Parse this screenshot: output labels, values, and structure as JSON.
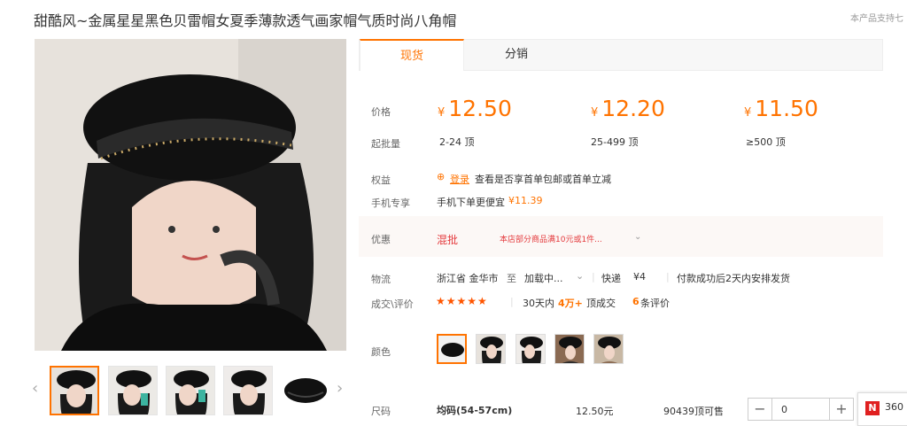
{
  "product": {
    "title": "甜酷风~金属星星黑色贝雷帽女夏季薄款透气画家帽气质时尚八角帽",
    "support_notice": "本产品支持七"
  },
  "gallery": {
    "prev_arrow": "‹",
    "next_arrow": "›"
  },
  "tabs": [
    {
      "label": "现货"
    },
    {
      "label": "分销"
    }
  ],
  "pricing": {
    "price_label": "价格",
    "moq_label": "起批量",
    "currency": "¥",
    "tiers": [
      {
        "price": "12.50",
        "range": "2-24 顶"
      },
      {
        "price": "12.20",
        "range": "25-499 顶"
      },
      {
        "price": "11.50",
        "range": "≥500 顶"
      }
    ]
  },
  "benefits": {
    "label": "权益",
    "login_link": "登录",
    "text": "查看是否享首单包邮或首单立减"
  },
  "mobile": {
    "label": "手机专享",
    "text": "手机下单更便宜",
    "price": "¥11.39"
  },
  "promo": {
    "label": "优惠",
    "mixed": "混批",
    "desc": "本店部分商品满10元或1件..."
  },
  "logistics": {
    "label": "物流",
    "from": "浙江省 金华市",
    "to_word": "至",
    "dest": "加载中...",
    "express": "快递",
    "fee": "¥4",
    "ship_note": "付款成功后2天内安排发货"
  },
  "deals": {
    "label": "成交\\评价",
    "stars": "★★★★★",
    "period": "30天内",
    "count": "4万+",
    "unit": "顶成交",
    "reviews": "6",
    "reviews_unit": "条评价"
  },
  "color": {
    "label": "颜色"
  },
  "size": {
    "label": "尺码",
    "name": "均码(54-57cm)",
    "price": "12.50元",
    "stock": "90439顶可售",
    "qty": "0",
    "minus": "−",
    "plus": "+"
  },
  "ad": {
    "logo": "N",
    "text": "360"
  },
  "colors": {
    "accent": "#ff7300",
    "star": "#ff5500"
  }
}
